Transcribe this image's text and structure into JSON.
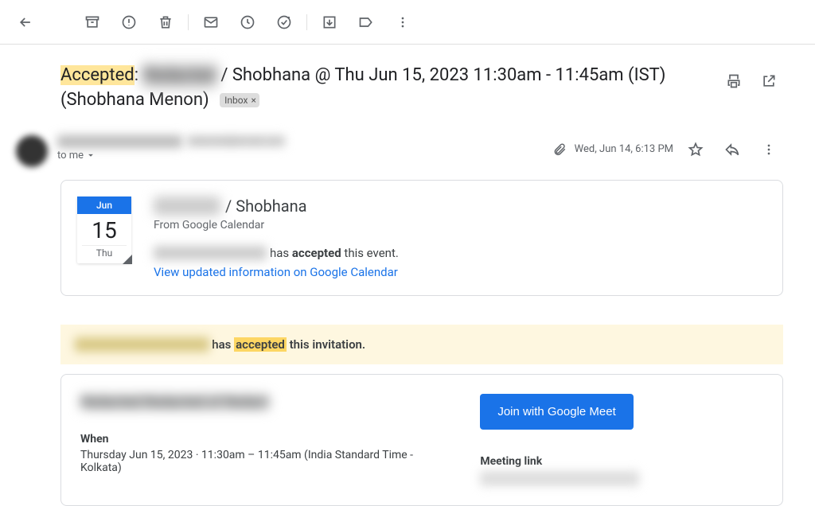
{
  "subject": {
    "prefix_highlight": "Accepted",
    "colon": ": ",
    "redacted1": "Redacted",
    "after_redacted": " / Shobhana @ Thu Jun 15, 2023 11:30am - 11:45am (IST) (Shobhana Menon)",
    "label": "Inbox"
  },
  "sender": {
    "name_redacted": "Redacted Redactedname",
    "email_redacted": "redacted@email.com",
    "to": "to me"
  },
  "meta": {
    "date": "Wed, Jun 14, 6:13 PM"
  },
  "calcard": {
    "month": "Jun",
    "day": "15",
    "dow": "Thu",
    "title_redacted": "Redacted",
    "title_rest": " / Shobhana",
    "from": "From Google Calendar",
    "status_redacted": "redacted@email.com",
    "status_mid": " has ",
    "status_bold": "accepted",
    "status_end": " this event.",
    "link": "View updated information on Google Calendar"
  },
  "banner": {
    "redacted": "Redacted Redactedname",
    "mid1": " has ",
    "accepted": "accepted",
    "mid2": " this invitation."
  },
  "event": {
    "title_redacted": "Redacted Redacted of Redact",
    "when_label": "When",
    "when_value": "Thursday Jun 15, 2023 · 11:30am – 11:45am (India Standard Time - Kolkata)",
    "meet_button": "Join with Google Meet",
    "meeting_link_label": "Meeting link",
    "meeting_link_redacted": "meet.google.com/xxxx-xxxx"
  }
}
